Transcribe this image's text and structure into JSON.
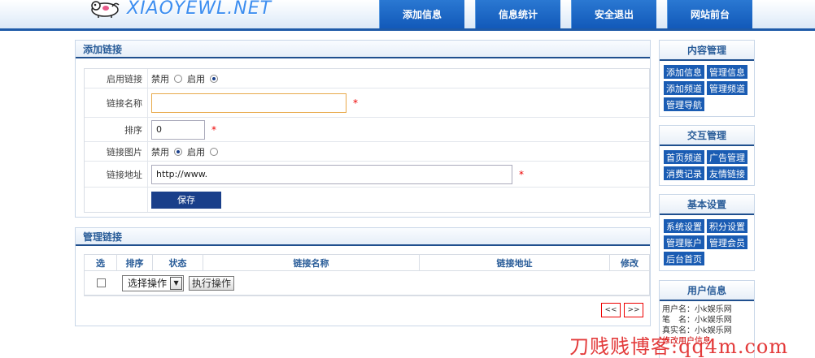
{
  "header": {
    "logo_text": "XIAOYEWL.NET",
    "nav": [
      "添加信息",
      "信息统计",
      "安全退出",
      "网站前台"
    ]
  },
  "add_link": {
    "title": "添加链接",
    "rows": {
      "enable": {
        "label": "启用链接",
        "opt_off": "禁用",
        "opt_on": "启用",
        "selected": "on"
      },
      "name": {
        "label": "链接名称",
        "value": "",
        "required": "*"
      },
      "order": {
        "label": "排序",
        "value": "0",
        "required": "*"
      },
      "image": {
        "label": "链接图片",
        "opt_off": "禁用",
        "opt_on": "启用",
        "selected": "off"
      },
      "url": {
        "label": "链接地址",
        "value": "http://www.",
        "required": "*"
      }
    },
    "save_label": "保存"
  },
  "manage_link": {
    "title": "管理链接",
    "columns": [
      "选",
      "排序",
      "状态",
      "链接名称",
      "链接地址",
      "修改"
    ],
    "select_value": "选择操作",
    "exec_label": "执行操作",
    "prev_label": "<<",
    "next_label": ">>"
  },
  "sidebar": {
    "content": {
      "title": "内容管理",
      "links": [
        "添加信息",
        "管理信息",
        "添加频道",
        "管理频道",
        "管理导航"
      ]
    },
    "interact": {
      "title": "交互管理",
      "links": [
        "首页频道",
        "广告管理",
        "消费记录",
        "友情链接"
      ]
    },
    "basic": {
      "title": "基本设置",
      "links": [
        "系统设置",
        "积分设置",
        "管理账户",
        "管理会员",
        "后台首页"
      ]
    },
    "user": {
      "title": "用户信息",
      "username": "用户名：小k娱乐网",
      "nickname": "笔　名：小k娱乐网",
      "realname": "真实名：小k娱乐网",
      "modify": "修改用户信息"
    }
  },
  "watermark": "刀贱贱博客:qq4m.com",
  "colors": {
    "accent": "#1a5cb3",
    "nav": "#1259b9",
    "required": "#e00000"
  }
}
